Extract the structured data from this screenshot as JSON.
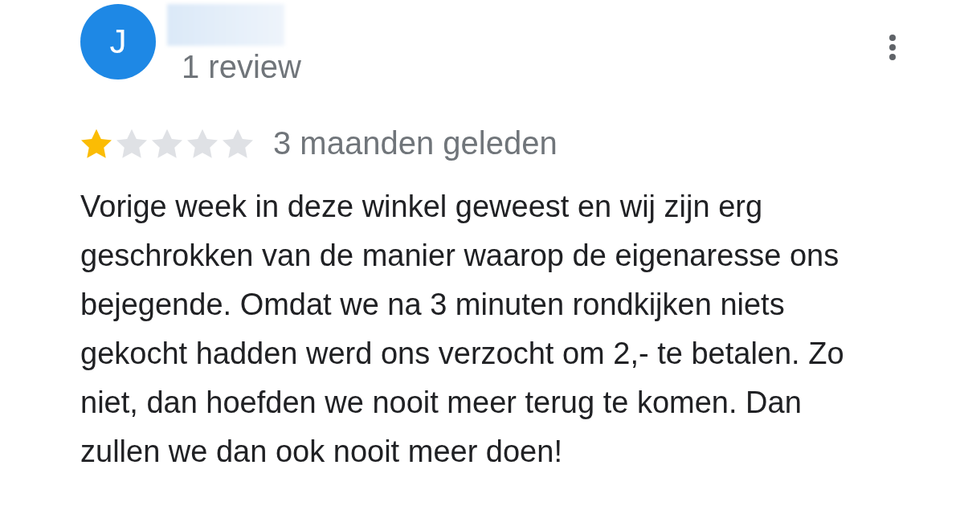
{
  "reviewer": {
    "initial": "J",
    "review_count": "1 review"
  },
  "review": {
    "stars": 1,
    "time": "3 maanden geleden",
    "text": "Vorige week in deze winkel geweest en wij zijn erg geschrokken van de manier waarop de eigenaresse ons bejegende. Omdat we na 3 minuten rondkijken niets gekocht hadden werd ons verzocht om 2,- te betalen. Zo niet, dan hoefden we nooit meer terug te komen. Dan zullen we dan ook nooit meer doen!"
  }
}
